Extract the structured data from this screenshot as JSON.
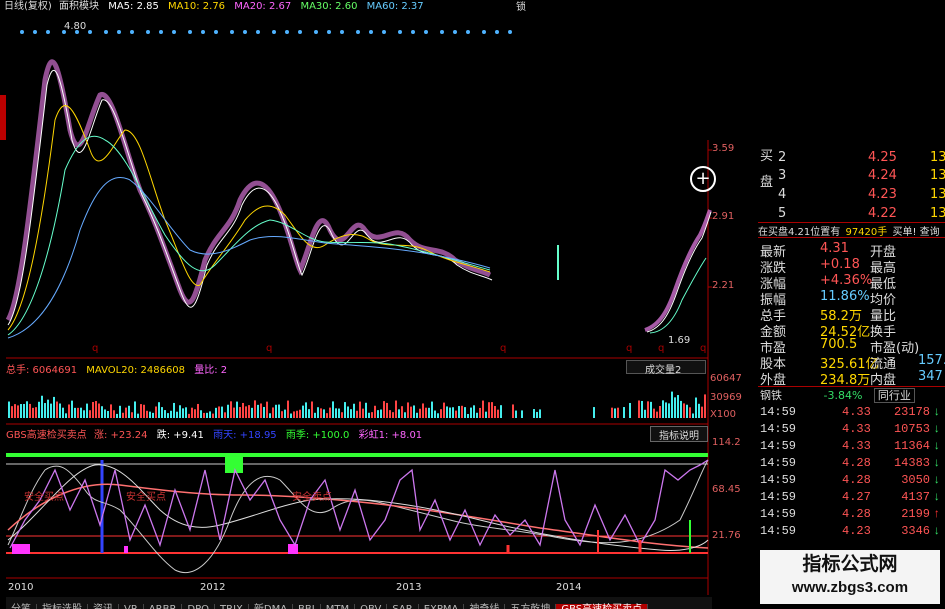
{
  "header": {
    "title": "日线(复权)",
    "mode": "面积模块",
    "ma5": "MA5: 2.85",
    "ma10": "MA10: 2.76",
    "ma20": "MA20: 2.67",
    "ma30": "MA30: 2.60",
    "ma60": "MA60: 2.37",
    "corner_btn": "锁"
  },
  "price_panel": {
    "axis_labels": [
      "3.59",
      "2.91",
      "2.21"
    ],
    "peak_label": "4.80",
    "low_label": "1.69",
    "q_marks": [
      "q",
      "q",
      "q",
      "q",
      "q",
      "q"
    ]
  },
  "volume_panel": {
    "total": "总手: 6064691",
    "mavol": "MAVOL20: 2486608",
    "ratio": "量比: 2",
    "selector": "成交量2",
    "axis_labels": [
      "60647",
      "30969",
      "X100"
    ]
  },
  "indicator_panel": {
    "name": "GBS高速检买卖点",
    "v1": "涨: +23.24",
    "v2": "跌: +9.41",
    "v3": "雨天: +18.95",
    "v4": "雨季: +100.0",
    "v5": "彩虹1: +8.01",
    "help_btn": "指标说明",
    "axis_labels": [
      "114.2",
      "68.45",
      "21.76"
    ],
    "annotations": [
      "安全买点",
      "安全买点",
      "安全卖点"
    ],
    "years": [
      "2010",
      "2012",
      "2013",
      "2014"
    ]
  },
  "bottom_tabs": [
    "分笔",
    "指标选股",
    "资讯",
    "VR",
    "ARBR",
    "DPO",
    "TRIX",
    "新DMA",
    "BBI",
    "MTM",
    "OBV",
    "SAR",
    "EXPMA",
    "神奇线",
    "五方乾坤",
    "GBS高速检买卖点"
  ],
  "order_book": {
    "bid_side_label": "买盘",
    "rows": [
      {
        "lvl": "2",
        "price": "4.25",
        "vol": "13"
      },
      {
        "lvl": "3",
        "price": "4.24",
        "vol": "13"
      },
      {
        "lvl": "4",
        "price": "4.23",
        "vol": "13"
      },
      {
        "lvl": "5",
        "price": "4.22",
        "vol": "13"
      }
    ],
    "queue": "在买盘4.21位置有",
    "queue_qty": "97420手",
    "queue_tail": "买单! 查询"
  },
  "stats": [
    {
      "k": "最新",
      "v": "4.31",
      "k2": "开盘"
    },
    {
      "k": "涨跌",
      "v": "+0.18",
      "k2": "最高"
    },
    {
      "k": "涨幅",
      "v": "+4.36%",
      "k2": "最低"
    },
    {
      "k": "振幅",
      "v": "11.86%",
      "k2": "均价"
    },
    {
      "k": "总手",
      "v": "58.2万",
      "k2": "量比"
    },
    {
      "k": "金额",
      "v": "24.52亿",
      "k2": "换手"
    },
    {
      "k": "市盈",
      "v": "700.5",
      "k2": "市盈(动)"
    },
    {
      "k": "股本",
      "v": "325.61亿",
      "k2": "流通",
      "v2": "157."
    },
    {
      "k": "外盘",
      "v": "234.8万",
      "k2": "内盘",
      "v2": "347"
    }
  ],
  "sector": {
    "name": "钢铁",
    "chg": "-3.84%",
    "btn": "同行业"
  },
  "ticks": [
    {
      "t": "14:59",
      "p": "4.33",
      "q": "23178",
      "d": "down"
    },
    {
      "t": "14:59",
      "p": "4.33",
      "q": "10753",
      "d": "down"
    },
    {
      "t": "14:59",
      "p": "4.33",
      "q": "11364",
      "d": "down"
    },
    {
      "t": "14:59",
      "p": "4.28",
      "q": "14383",
      "d": "down"
    },
    {
      "t": "14:59",
      "p": "4.28",
      "q": "3050",
      "d": "down"
    },
    {
      "t": "14:59",
      "p": "4.27",
      "q": "4137",
      "d": "down"
    },
    {
      "t": "14:59",
      "p": "4.28",
      "q": "2199",
      "d": "up"
    },
    {
      "t": "14:59",
      "p": "4.23",
      "q": "3346",
      "d": "down"
    }
  ],
  "watermark": {
    "line1": "指标公式网",
    "line2": "www.zbgs3.com"
  },
  "colors": {
    "up": "#ff3333",
    "down": "#33dd66",
    "axis": "#aa0000",
    "label": "#e0e0e0",
    "accent": "#ffff00"
  }
}
